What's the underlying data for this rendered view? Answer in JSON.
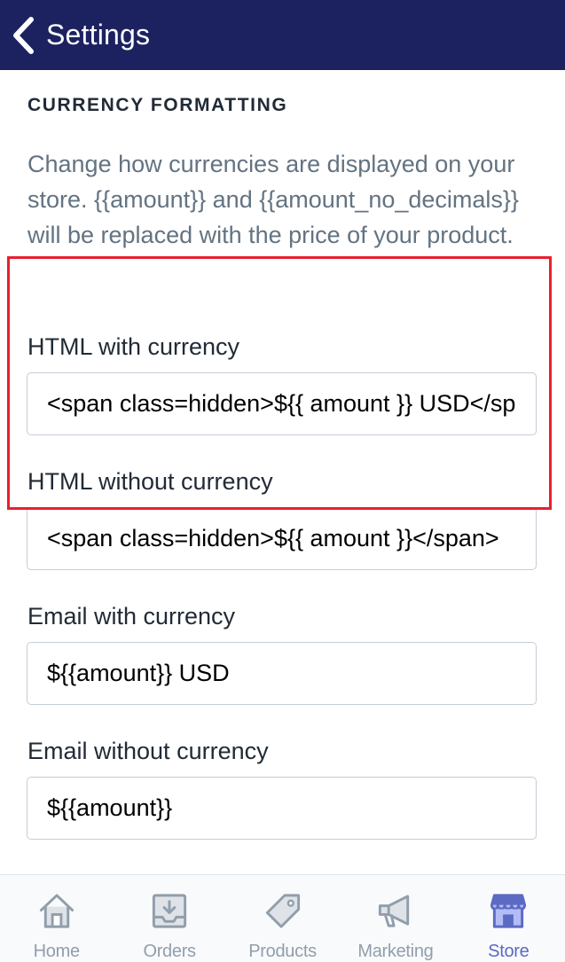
{
  "header": {
    "back_icon": "chevron-left-icon",
    "title": "Settings"
  },
  "section": {
    "heading": "CURRENCY FORMATTING",
    "description": "Change how currencies are displayed on your store. {{amount}} and {{amount_no_decimals}} will be replaced with the price of your product."
  },
  "fields": [
    {
      "label": "HTML with currency",
      "value": "<span class=hidden>${{ amount }} USD</span>"
    },
    {
      "label": "HTML without currency",
      "value": "<span class=hidden>${{ amount }}</span>"
    },
    {
      "label": "Email with currency",
      "value": "${{amount}} USD"
    },
    {
      "label": "Email without currency",
      "value": "${{amount}}"
    }
  ],
  "highlight": {
    "color": "#e8202e"
  },
  "tabs": [
    {
      "label": "Home",
      "icon": "home-icon",
      "active": false
    },
    {
      "label": "Orders",
      "icon": "orders-inbox-icon",
      "active": false
    },
    {
      "label": "Products",
      "icon": "tag-icon",
      "active": false
    },
    {
      "label": "Marketing",
      "icon": "megaphone-icon",
      "active": false
    },
    {
      "label": "Store",
      "icon": "store-icon",
      "active": true
    }
  ],
  "colors": {
    "nav_bar": "#1c2260",
    "active_tab": "#5c6ac4",
    "inactive_tab": "#919eab",
    "description_text": "#637381"
  }
}
